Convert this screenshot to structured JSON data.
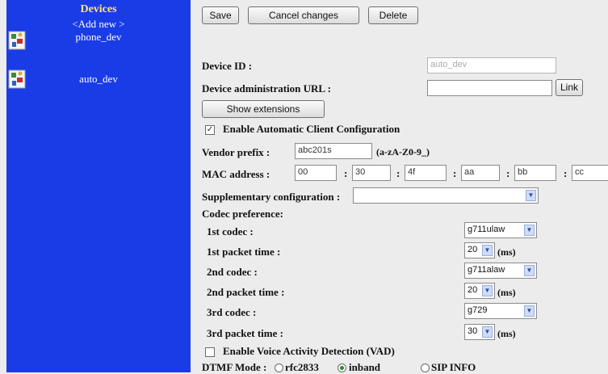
{
  "sidebar": {
    "title": "Devices",
    "add_new": "<Add new >",
    "devices": [
      {
        "label": "phone_dev",
        "icon": "device-image-icon"
      },
      {
        "label": "auto_dev",
        "icon": "device-image-icon"
      }
    ]
  },
  "toolbar": {
    "save": "Save",
    "cancel": "Cancel changes",
    "delete": "Delete"
  },
  "form": {
    "device_id_label": "Device ID :",
    "device_id_value": "auto_dev",
    "admin_url_label": "Device administration URL :",
    "admin_url_value": "",
    "link_button": "Link",
    "show_extensions": "Show extensions",
    "auto_config_label": "Enable Automatic Client Configuration",
    "auto_config_checked": "✓",
    "vendor_prefix_label": "Vendor prefix :",
    "vendor_prefix_value": "abc201s",
    "vendor_prefix_hint": "(a-zA-Z0-9_)",
    "mac_label": "MAC address :",
    "mac_sep": ":",
    "mac": [
      "00",
      "30",
      "4f",
      "aa",
      "bb",
      "cc"
    ],
    "supp_config_label": "Supplementary configuration :",
    "supp_config_value": "",
    "codec_pref_label": "Codec preference:",
    "codec_rows": [
      {
        "label": "1st codec :",
        "value": "g711ulaw"
      },
      {
        "label": "1st packet time :",
        "value": "20",
        "unit": "(ms)"
      },
      {
        "label": "2nd codec :",
        "value": "g711alaw"
      },
      {
        "label": "2nd packet time :",
        "value": "20",
        "unit": "(ms)"
      },
      {
        "label": "3rd codec :",
        "value": "g729"
      },
      {
        "label": "3rd packet time :",
        "value": "30",
        "unit": "(ms)"
      }
    ],
    "vad_label": "Enable Voice Activity Detection (VAD)",
    "dtmf_label": "DTMF Mode :",
    "dtmf_options": [
      "rfc2833",
      "inband",
      "SIP INFO"
    ],
    "dtmf_selected": "inband"
  },
  "colors": {
    "sidebar_bg": "#1a3ce6",
    "sidebar_title": "#ffe86a",
    "page_bg": "#ececec"
  }
}
